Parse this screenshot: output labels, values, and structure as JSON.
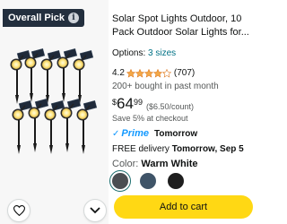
{
  "badge": {
    "label": "Overall Pick",
    "icon": "info-icon"
  },
  "product": {
    "title": "Solar Spot Lights Outdoor, 10 Pack Outdoor Solar Lights for...",
    "options_label": "Options:",
    "options_value": "3 sizes",
    "rating": "4.2",
    "rating_count": "(707)",
    "bought": "200+ bought in past month",
    "price_symbol": "$",
    "price_whole": "64",
    "price_fraction": "99",
    "unit_price": "($6.50/count)",
    "save_note": "Save 5% at checkout",
    "prime_label": "Prime",
    "prime_when": "Tomorrow",
    "delivery_prefix": "FREE delivery",
    "delivery_date": "Tomorrow, Sep 5",
    "color_label": "Color:",
    "color_value": "Warm White",
    "add_to_cart": "Add to cart"
  },
  "swatches": [
    {
      "name": "Warm White",
      "color": "#4a4e52",
      "selected": true
    },
    {
      "name": "Blue",
      "color": "#3f5468"
    },
    {
      "name": "Black",
      "color": "#1e1e1e"
    }
  ],
  "colors": {
    "prime": "#1399ff",
    "link": "#007185",
    "star": "#f3a847",
    "button": "#ffd814",
    "badge": "#232f3e"
  },
  "icons": {
    "wishlist": "heart-icon",
    "more": "chevron-down-icon"
  }
}
